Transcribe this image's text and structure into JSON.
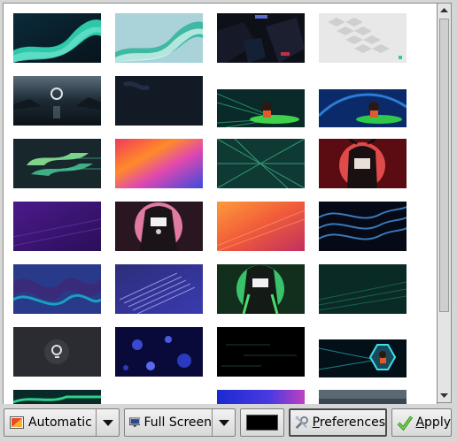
{
  "toolbar": {
    "style_select": {
      "value": "Automatic"
    },
    "mode_select": {
      "value": "Full Screen"
    },
    "background_color": "#000000",
    "preferences_button": {
      "label_prefix": "",
      "mnemonic": "P",
      "label_rest": "references"
    },
    "apply_button": {
      "mnemonic": "A",
      "label_rest": "pply"
    }
  },
  "wallpapers": [
    {
      "name": "teal-wave-dark"
    },
    {
      "name": "teal-wave-light"
    },
    {
      "name": "dark-cubes-logo"
    },
    {
      "name": "white-cubes"
    },
    {
      "name": "lake-logo-night"
    },
    {
      "name": "dark-navy-abstract"
    },
    {
      "name": "kid-on-leaf-green"
    },
    {
      "name": "kid-on-leaf-blue"
    },
    {
      "name": "green-speed-logo"
    },
    {
      "name": "rainbow-gradient"
    },
    {
      "name": "green-burst"
    },
    {
      "name": "red-hood-figure"
    },
    {
      "name": "purple-fur"
    },
    {
      "name": "pink-hood-figure"
    },
    {
      "name": "orange-fur"
    },
    {
      "name": "blue-waves-dark"
    },
    {
      "name": "blue-marble-swirl"
    },
    {
      "name": "lavender-fur"
    },
    {
      "name": "green-hood-figure"
    },
    {
      "name": "dark-teal-waves"
    },
    {
      "name": "grey-logo-dark"
    },
    {
      "name": "blue-bubbles"
    },
    {
      "name": "black-glitch"
    },
    {
      "name": "kid-hexagon-teal"
    },
    {
      "name": "partial-teal"
    },
    {
      "name": "empty-slot"
    },
    {
      "name": "partial-blue-purple"
    },
    {
      "name": "partial-grey"
    }
  ]
}
